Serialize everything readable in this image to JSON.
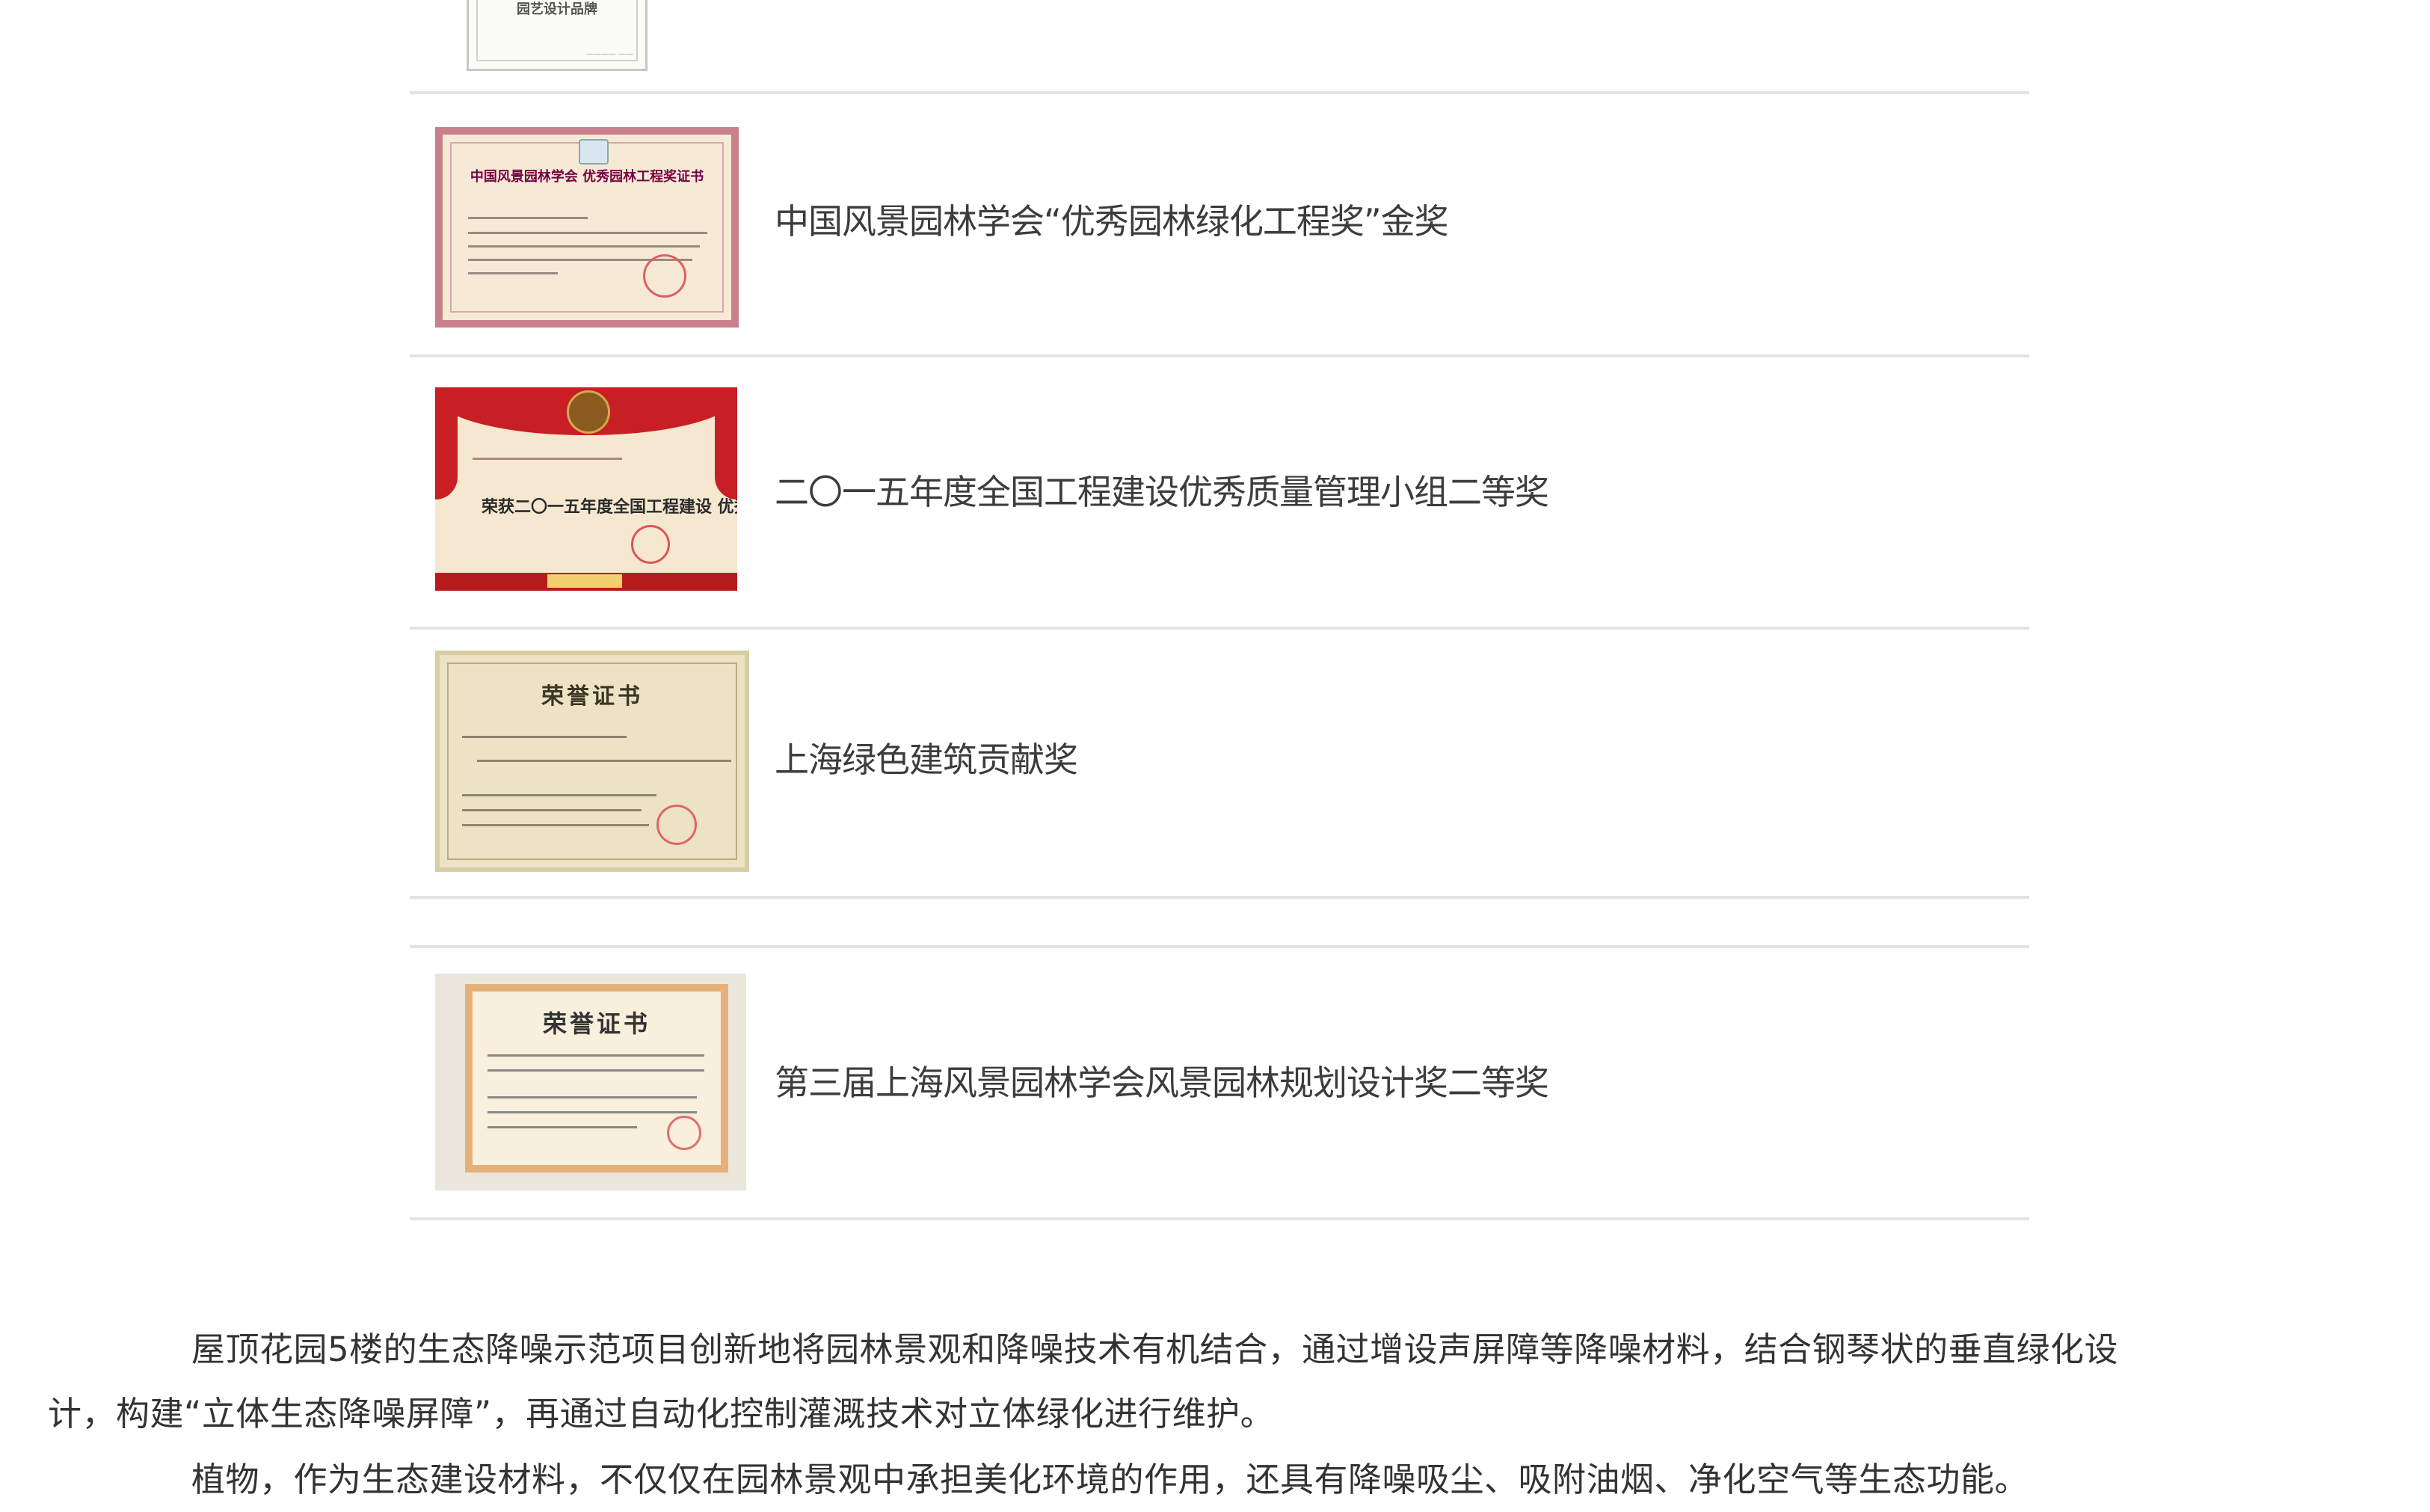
{
  "awards": [
    {
      "title": "",
      "cert_text": "园艺设计品牌"
    },
    {
      "title": "中国风景园林学会“优秀园林绿化工程奖”金奖",
      "cert_text": "中国风景园林学会 优秀园林工程奖证书"
    },
    {
      "title": "二〇一五年度全国工程建设优秀质量管理小组二等奖",
      "cert_text": "荣获二〇一五年度全国工程建设 优秀质量管理小组二等奖"
    },
    {
      "title": "上海绿色建筑贡献奖",
      "cert_text": "荣誉证书"
    },
    {
      "title": "第三届上海风景园林学会风景园林规划设计奖二等奖",
      "cert_text": "荣誉证书"
    }
  ],
  "paragraphs": {
    "p1_line1": "屋顶花园5楼的生态降噪示范项目创新地将园林景观和降噪技术有机结合，通过增设声屏障等降噪材料，结合钢琴状的垂直绿化设",
    "p1_line2": "计，构建“立体生态降噪屏障”，再通过自动化控制灌溉技术对立体绿化进行维护。",
    "p2": "植物，作为生态建设材料，不仅仅在园林景观中承担美化环境的作用，还具有降噪吸尘、吸附油烟、净化空气等生态功能。"
  }
}
